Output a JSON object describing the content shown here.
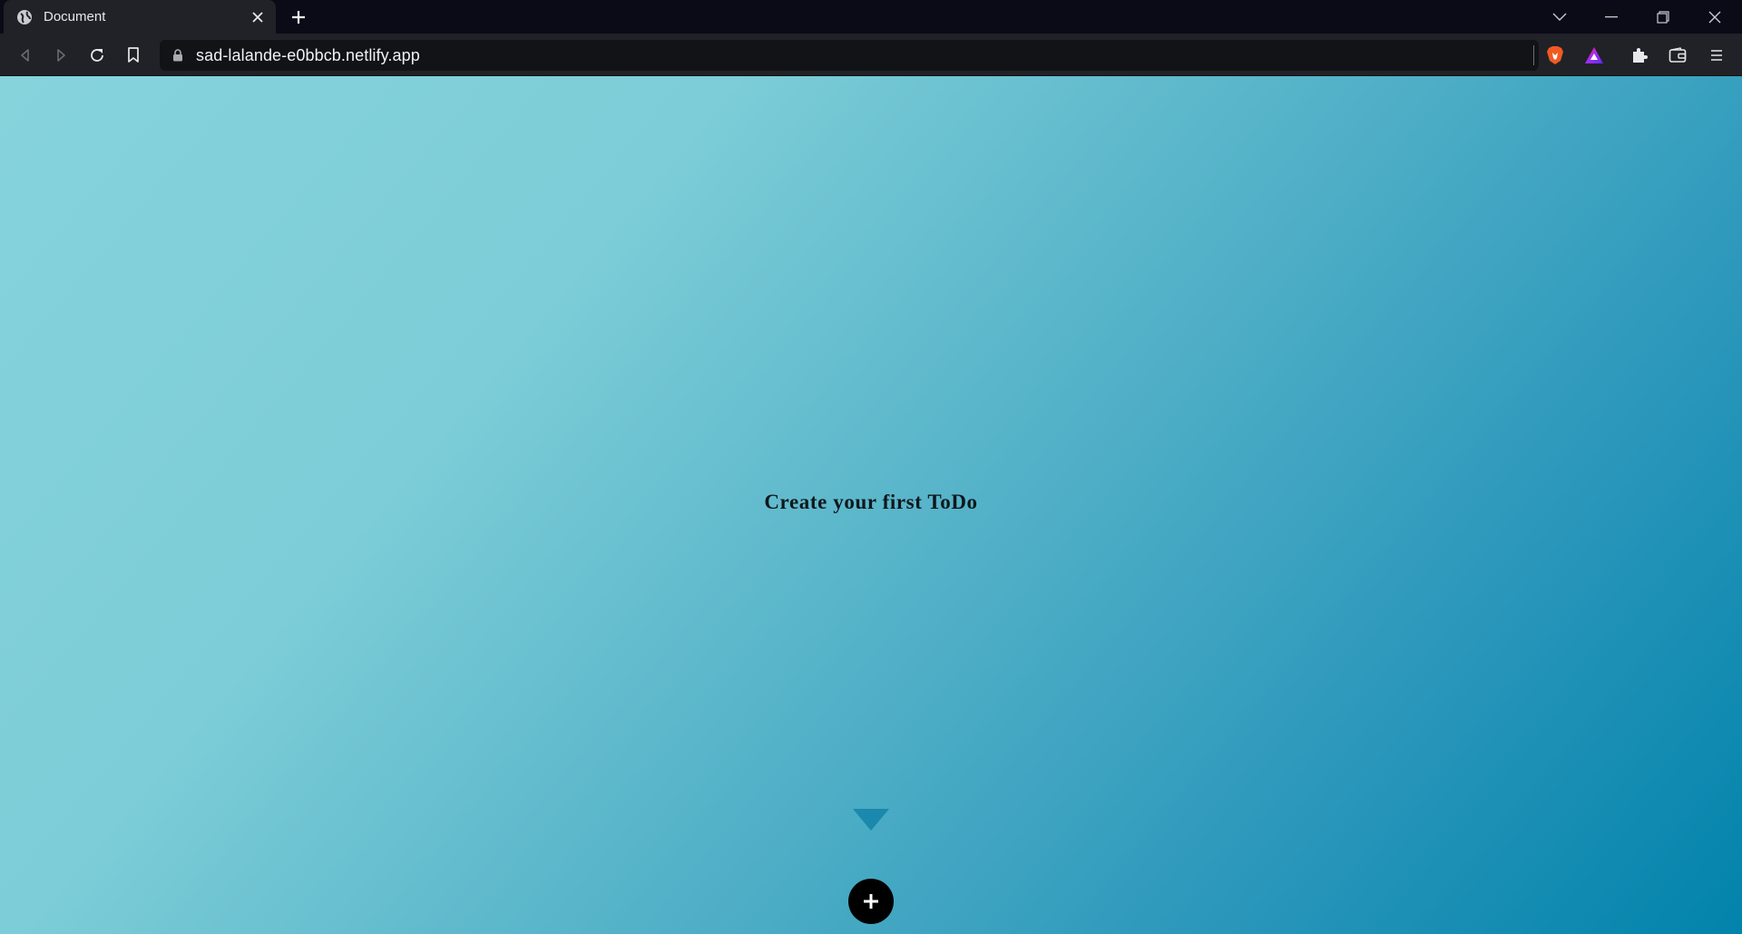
{
  "browser": {
    "tab": {
      "title": "Document",
      "favicon": "globe-icon"
    },
    "new_tab_icon": "plus-icon",
    "window_controls": [
      "chevron-down-icon",
      "minimize-icon",
      "restore-icon",
      "close-icon"
    ],
    "toolbar": {
      "url": "sad-lalande-e0bbcb.netlify.app",
      "icons": [
        "back-icon",
        "forward-icon",
        "reload-icon",
        "bookmark-icon",
        "lock-icon",
        "brave-shields-icon",
        "brave-rewards-icon",
        "extensions-icon",
        "wallet-icon",
        "menu-icon"
      ]
    }
  },
  "page": {
    "empty_message": "Create your first ToDo",
    "add_button_icon": "plus-icon",
    "arrow_icon": "triangle-down-icon",
    "colors": {
      "gradient_start": "#86d3dc",
      "gradient_end": "#0283ab",
      "arrow": "#1b88ad",
      "add_button": "#000000"
    }
  }
}
